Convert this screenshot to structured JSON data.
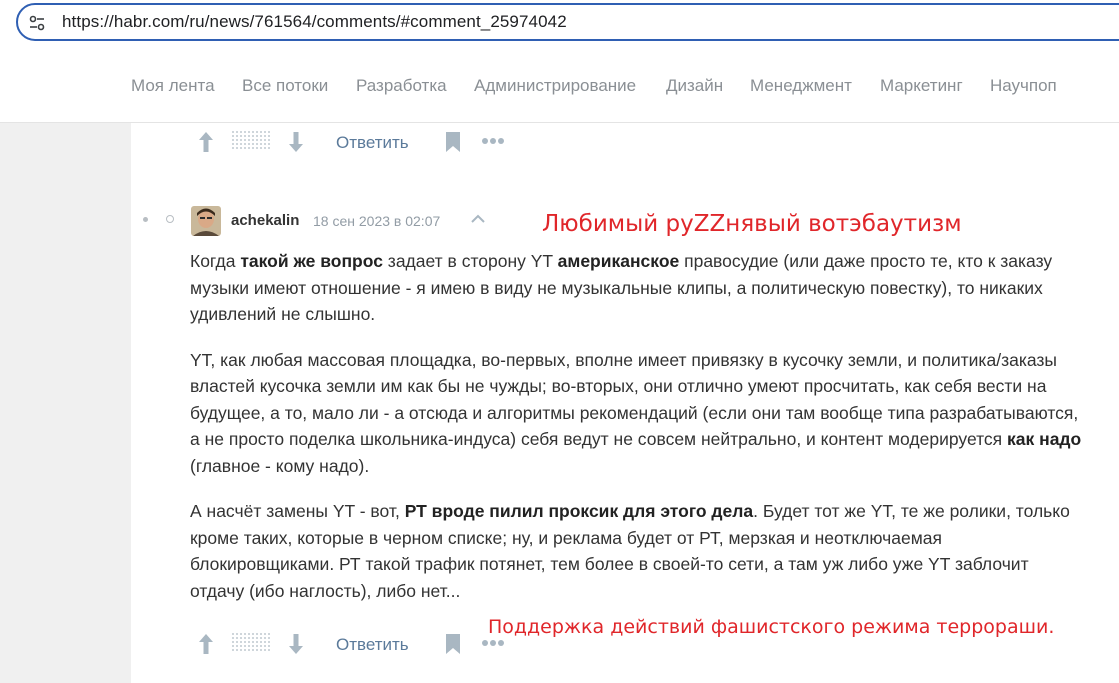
{
  "browser": {
    "url": "https://habr.com/ru/news/761564/comments/#comment_25974042"
  },
  "nav": {
    "items": [
      "Моя лента",
      "Все потоки",
      "Разработка",
      "Администрирование",
      "Дизайн",
      "Менеджмент",
      "Маркетинг",
      "Научпоп"
    ]
  },
  "actions": {
    "reply_label": "Ответить"
  },
  "comment": {
    "author": "achekalin",
    "date": "18 сен 2023 в 02:07",
    "paragraphs": [
      [
        {
          "t": "Когда "
        },
        {
          "t": "такой же вопрос",
          "b": true
        },
        {
          "t": " задает в сторону YT "
        },
        {
          "t": "американское",
          "b": true
        },
        {
          "t": " правосудие (или даже просто те, кто к заказу музыки имеют отношение - я имею в виду не музыкальные клипы, а политическую повестку), то никаких удивлений не слышно."
        }
      ],
      [
        {
          "t": "YT, как любая массовая площадка, во-первых, вполне имеет привязку в кусочку земли, и политика/заказы властей кусочка земли им как бы не чужды; во-вторых, они отлично умеют просчитать, как себя вести на будущее, а то, мало ли - а отсюда и алгоритмы рекомендаций (если они там вообще типа разрабатываются, а не просто поделка школьника-индуса) себя ведут не совсем нейтрально, и контент модерируется "
        },
        {
          "t": "как надо",
          "b": true
        },
        {
          "t": " (главное - кому надо)."
        }
      ],
      [
        {
          "t": "А насчёт замены YT - вот, "
        },
        {
          "t": "РТ вроде пилил проксик для этого дела",
          "b": true
        },
        {
          "t": ". Будет тот же YT, те же ролики, только кроме таких, которые в черном списке; ну, и реклама будет от РТ, мерзкая и неотключаемая блокировщиками. РТ такой трафик потянет, тем более в своей-то сети, а там уж либо уже YT заблочит отдачу (ибо наглость), либо нет..."
        }
      ]
    ]
  },
  "annotations": {
    "top": "Любимый руZZнявый вотэбаутизм",
    "bottom": "Поддержка действий фашистского режима террораши."
  },
  "colors": {
    "accent_blue": "#2f5fb3",
    "annotation_red": "#e0262a",
    "link": "#5b7a9a"
  }
}
